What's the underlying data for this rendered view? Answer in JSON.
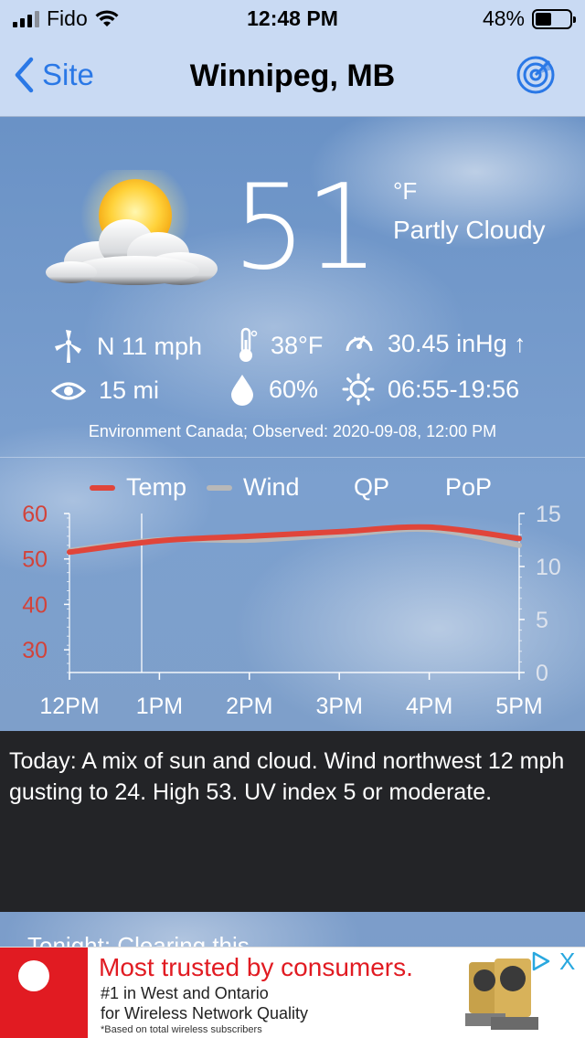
{
  "status_bar": {
    "carrier": "Fido",
    "time": "12:48 PM",
    "battery": "48%",
    "battery_level": 0.48
  },
  "nav": {
    "back_label": "Site",
    "title": "Winnipeg, MB",
    "radar_icon": "radar-icon"
  },
  "current": {
    "temperature": "51",
    "unit": "°F",
    "condition": "Partly Cloudy",
    "condition_icon": "partly-cloudy-icon",
    "wind": "N 11 mph",
    "dewpoint": "38°F",
    "pressure": "30.45 inHg ↑",
    "visibility": "15 mi",
    "humidity": "60%",
    "sun": "06:55-19:56",
    "observed": "Environment Canada; Observed: 2020-09-08, 12:00 PM"
  },
  "legend": {
    "temp": "Temp",
    "wind": "Wind",
    "qp": "QP",
    "pop": "PoP"
  },
  "colors": {
    "temp": "#e0453a",
    "wind": "#b8b8b8",
    "accent": "#2a78e6",
    "forecast_bg": "#232427",
    "ad_red": "#e11b22"
  },
  "chart_data": {
    "type": "line",
    "x": [
      "12PM",
      "1PM",
      "2PM",
      "3PM",
      "4PM",
      "5PM"
    ],
    "series": [
      {
        "name": "Temp",
        "axis": "left",
        "values": [
          51.5,
          54,
          55,
          56,
          57,
          54.5
        ]
      },
      {
        "name": "Wind",
        "axis": "right",
        "values": [
          11.5,
          12.5,
          12.5,
          13,
          13.5,
          12
        ]
      }
    ],
    "y_left": {
      "ticks": [
        "60",
        "50",
        "40",
        "30"
      ],
      "range": [
        25,
        60
      ]
    },
    "y_right": {
      "ticks": [
        "15",
        "10",
        "5",
        "0"
      ],
      "range": [
        0,
        15
      ]
    },
    "grid": false
  },
  "forecast": {
    "text": "Today:  A mix of sun and cloud. Wind northwest 12 mph gusting to 24. High 53. UV index 5 or moderate."
  },
  "next_peek": "Tonight:    Clearing this ...",
  "ad": {
    "headline": "Most trusted by consumers.",
    "line1": "#1 in West and Ontario",
    "line2": "for Wireless Network Quality",
    "footnote": "*Based on total wireless subscribers",
    "close": "X"
  }
}
